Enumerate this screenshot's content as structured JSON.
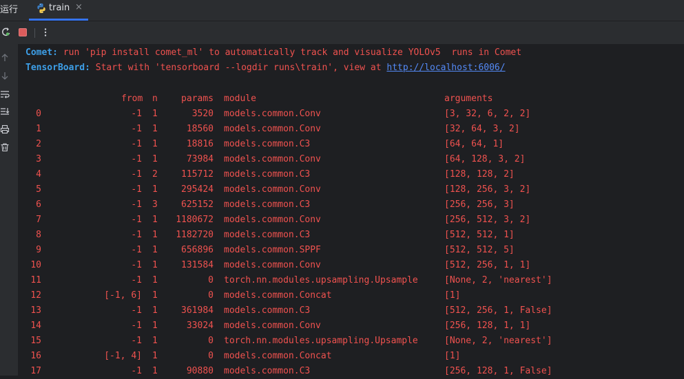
{
  "window": {
    "run_label": "运行"
  },
  "tab": {
    "label": "train",
    "close": "×"
  },
  "toolbar": {
    "rerun": "rerun-icon",
    "stop": "stop-icon",
    "more": "more-vertical-icon"
  },
  "console": {
    "comet_prefix": "Comet:",
    "comet_text": " run 'pip install comet_ml' to automatically track and visualize YOLOv5  runs in Comet",
    "tb_prefix": "TensorBoard:",
    "tb_text": " Start with 'tensorboard --logdir runs\\train', view at ",
    "tb_link": "http://localhost:6006/",
    "headers": {
      "from": "from",
      "n": "n",
      "params": "params",
      "module": "module",
      "arguments": "arguments"
    },
    "rows": [
      {
        "idx": "0",
        "from": "-1",
        "n": "1",
        "params": "3520",
        "module": "models.common.Conv",
        "args": "[3, 32, 6, 2, 2]"
      },
      {
        "idx": "1",
        "from": "-1",
        "n": "1",
        "params": "18560",
        "module": "models.common.Conv",
        "args": "[32, 64, 3, 2]"
      },
      {
        "idx": "2",
        "from": "-1",
        "n": "1",
        "params": "18816",
        "module": "models.common.C3",
        "args": "[64, 64, 1]"
      },
      {
        "idx": "3",
        "from": "-1",
        "n": "1",
        "params": "73984",
        "module": "models.common.Conv",
        "args": "[64, 128, 3, 2]"
      },
      {
        "idx": "4",
        "from": "-1",
        "n": "2",
        "params": "115712",
        "module": "models.common.C3",
        "args": "[128, 128, 2]"
      },
      {
        "idx": "5",
        "from": "-1",
        "n": "1",
        "params": "295424",
        "module": "models.common.Conv",
        "args": "[128, 256, 3, 2]"
      },
      {
        "idx": "6",
        "from": "-1",
        "n": "3",
        "params": "625152",
        "module": "models.common.C3",
        "args": "[256, 256, 3]"
      },
      {
        "idx": "7",
        "from": "-1",
        "n": "1",
        "params": "1180672",
        "module": "models.common.Conv",
        "args": "[256, 512, 3, 2]"
      },
      {
        "idx": "8",
        "from": "-1",
        "n": "1",
        "params": "1182720",
        "module": "models.common.C3",
        "args": "[512, 512, 1]"
      },
      {
        "idx": "9",
        "from": "-1",
        "n": "1",
        "params": "656896",
        "module": "models.common.SPPF",
        "args": "[512, 512, 5]"
      },
      {
        "idx": "10",
        "from": "-1",
        "n": "1",
        "params": "131584",
        "module": "models.common.Conv",
        "args": "[512, 256, 1, 1]"
      },
      {
        "idx": "11",
        "from": "-1",
        "n": "1",
        "params": "0",
        "module": "torch.nn.modules.upsampling.Upsample",
        "args": "[None, 2, 'nearest']"
      },
      {
        "idx": "12",
        "from": "[-1, 6]",
        "n": "1",
        "params": "0",
        "module": "models.common.Concat",
        "args": "[1]"
      },
      {
        "idx": "13",
        "from": "-1",
        "n": "1",
        "params": "361984",
        "module": "models.common.C3",
        "args": "[512, 256, 1, False]"
      },
      {
        "idx": "14",
        "from": "-1",
        "n": "1",
        "params": "33024",
        "module": "models.common.Conv",
        "args": "[256, 128, 1, 1]"
      },
      {
        "idx": "15",
        "from": "-1",
        "n": "1",
        "params": "0",
        "module": "torch.nn.modules.upsampling.Upsample",
        "args": "[None, 2, 'nearest']"
      },
      {
        "idx": "16",
        "from": "[-1, 4]",
        "n": "1",
        "params": "0",
        "module": "models.common.Concat",
        "args": "[1]"
      },
      {
        "idx": "17",
        "from": "-1",
        "n": "1",
        "params": "90880",
        "module": "models.common.C3",
        "args": "[256, 128, 1, False]"
      }
    ]
  }
}
